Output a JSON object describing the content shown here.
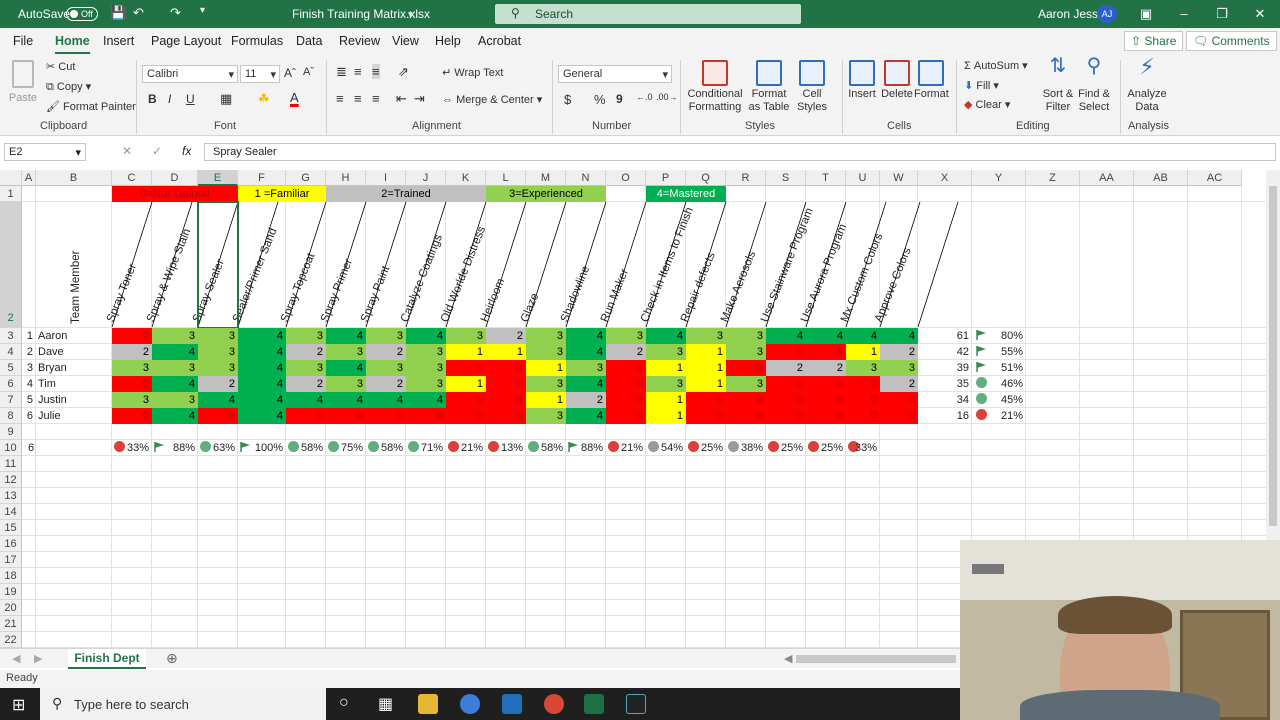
{
  "title_bar": {
    "autosave_label": "AutoSave",
    "autosave_state": "Off",
    "filename": "Finish Training Matrix.xlsx",
    "search_placeholder": "Search",
    "user_name": "Aaron Jesse",
    "user_initials": "AJ"
  },
  "menu": {
    "items": [
      "File",
      "Home",
      "Insert",
      "Page Layout",
      "Formulas",
      "Data",
      "Review",
      "View",
      "Help",
      "Acrobat"
    ],
    "active": "Home",
    "share_label": "Share",
    "comments_label": "Comments"
  },
  "ribbon": {
    "clipboard": {
      "paste": "Paste",
      "cut": "Cut",
      "copy": "Copy",
      "format_painter": "Format Painter",
      "group": "Clipboard"
    },
    "font": {
      "name": "Calibri",
      "size": "11",
      "group": "Font",
      "bold": "B",
      "italic": "I",
      "underline": "U"
    },
    "alignment": {
      "wrap_text": "Wrap Text",
      "merge_center": "Merge & Center",
      "group": "Alignment"
    },
    "number": {
      "format": "General",
      "currency": "$",
      "percent": "%",
      "comma": "9",
      "group": "Number"
    },
    "styles": {
      "conditional": "Conditional Formatting",
      "format_table": "Format as Table",
      "cell_styles": "Cell Styles",
      "group": "Styles"
    },
    "cells": {
      "insert": "Insert",
      "delete": "Delete",
      "format": "Format",
      "group": "Cells"
    },
    "editing": {
      "autosum": "AutoSum",
      "fill": "Fill",
      "clear": "Clear",
      "sort_filter": "Sort & Filter",
      "find_select": "Find & Select",
      "group": "Editing"
    },
    "analysis": {
      "analyze": "Analyze Data",
      "group": "Analysis"
    }
  },
  "formula_bar": {
    "name_box": "E2",
    "formula": "Spray Sealer"
  },
  "columns": [
    "A",
    "B",
    "C",
    "D",
    "E",
    "F",
    "G",
    "H",
    "I",
    "J",
    "K",
    "L",
    "M",
    "N",
    "O",
    "P",
    "Q",
    "R",
    "S",
    "T",
    "U",
    "W",
    "X",
    "Y",
    "Z",
    "AA",
    "AB",
    "AC"
  ],
  "row_numbers": [
    "1",
    "2",
    "3",
    "4",
    "5",
    "6",
    "7",
    "8",
    "9",
    "10",
    "11",
    "12",
    "13",
    "14",
    "15",
    "16",
    "17",
    "18",
    "19",
    "20",
    "21",
    "22"
  ],
  "legend": [
    {
      "label": "0=Not Trained",
      "color": "#ff0000",
      "text_color": "#c00000"
    },
    {
      "label": "1 =Familiar",
      "color": "#ffff00",
      "text_color": "#000000"
    },
    {
      "label": "2=Trained",
      "color": "#c0c0c0",
      "text_color": "#000000"
    },
    {
      "label": "3=Experienced",
      "color": "#92d050",
      "text_color": "#000000"
    },
    {
      "label": "4=Mastered",
      "color": "#00b050",
      "text_color": "#ffffff"
    }
  ],
  "team_member_header": "Team Member",
  "skills": [
    "Spray Toner",
    "Spray & Wipe Stain",
    "Spray Sealer",
    "Sealer/Primer Sand",
    "Spray Topcoat",
    "Spray Primer",
    "Spray Paint",
    "Catalyze Coatings",
    "Old Worlde Distress",
    "Heirloom",
    "Glaze",
    "Shadowline",
    "Run Maker",
    "Check in Items to Finish",
    "Repair defects",
    "Make Aerosols",
    "Use Stainware Program",
    "Use Aurora Program",
    "Mx Custom Colors",
    "Approve Colors"
  ],
  "members": [
    {
      "index": "1",
      "name": "Aaron",
      "scores": [
        0,
        3,
        3,
        4,
        3,
        4,
        3,
        4,
        3,
        2,
        3,
        4,
        3,
        4,
        3,
        3,
        4,
        4,
        4,
        4
      ],
      "total": "61",
      "pct": "80%",
      "icon": "flag"
    },
    {
      "index": "2",
      "name": "Dave",
      "scores": [
        2,
        4,
        3,
        4,
        2,
        3,
        2,
        3,
        1,
        1,
        3,
        4,
        2,
        3,
        1,
        3,
        0,
        0,
        1,
        2
      ],
      "total": "42",
      "pct": "55%",
      "icon": "flag"
    },
    {
      "index": "3",
      "name": "Bryan",
      "scores": [
        3,
        3,
        3,
        4,
        3,
        4,
        3,
        3,
        0,
        0,
        1,
        3,
        0,
        1,
        1,
        0,
        2,
        2,
        3,
        3
      ],
      "total": "39",
      "pct": "51%",
      "icon": "flag"
    },
    {
      "index": "4",
      "name": "Tim",
      "scores": [
        0,
        4,
        2,
        4,
        2,
        3,
        2,
        3,
        1,
        0,
        3,
        4,
        0,
        3,
        1,
        3,
        0,
        0,
        0,
        2
      ],
      "total": "35",
      "pct": "46%",
      "icon": "green"
    },
    {
      "index": "5",
      "name": "Justin",
      "scores": [
        3,
        3,
        4,
        4,
        4,
        4,
        4,
        4,
        0,
        0,
        1,
        2,
        0,
        1,
        0,
        0,
        0,
        0,
        0,
        0
      ],
      "total": "34",
      "pct": "45%",
      "icon": "green"
    },
    {
      "index": "6",
      "name": "Julie",
      "scores": [
        0,
        4,
        0,
        4,
        0,
        0,
        0,
        0,
        0,
        0,
        3,
        4,
        0,
        1,
        0,
        0,
        0,
        0,
        0,
        0
      ],
      "total": "16",
      "pct": "21%",
      "icon": "red"
    }
  ],
  "summary": {
    "count": "6",
    "items": [
      {
        "pct": "33%",
        "icon": "red"
      },
      {
        "pct": "88%",
        "icon": "flag"
      },
      {
        "pct": "63%",
        "icon": "green"
      },
      {
        "pct": "100%",
        "icon": "flag"
      },
      {
        "pct": "58%",
        "icon": "green"
      },
      {
        "pct": "75%",
        "icon": "green"
      },
      {
        "pct": "58%",
        "icon": "green"
      },
      {
        "pct": "71%",
        "icon": "green"
      },
      {
        "pct": "21%",
        "icon": "red"
      },
      {
        "pct": "13%",
        "icon": "red"
      },
      {
        "pct": "58%",
        "icon": "green"
      },
      {
        "pct": "88%",
        "icon": "flag"
      },
      {
        "pct": "21%",
        "icon": "red"
      },
      {
        "pct": "54%",
        "icon": "gray"
      },
      {
        "pct": "25%",
        "icon": "red"
      },
      {
        "pct": "38%",
        "icon": "gray"
      },
      {
        "pct": "25%",
        "icon": "red"
      },
      {
        "pct": "25%",
        "icon": "red"
      },
      {
        "pct": "33%",
        "icon": "red"
      }
    ]
  },
  "sheet_tab": "Finish Dept",
  "status": "Ready",
  "taskbar": {
    "search_placeholder": "Type here to search"
  },
  "score_colors": {
    "0": "#ff0000",
    "1": "#ffff00",
    "2": "#c0c0c0",
    "3": "#92d050",
    "4": "#00b050"
  },
  "score_text_colors": {
    "0": "#c00000",
    "1": "#000000",
    "2": "#000000",
    "3": "#000000",
    "4": "#000000"
  },
  "icon_colors": {
    "red": "#d9413a",
    "green": "#5fae7c",
    "gray": "#9a9a9a",
    "flag": "#3b8a54"
  }
}
